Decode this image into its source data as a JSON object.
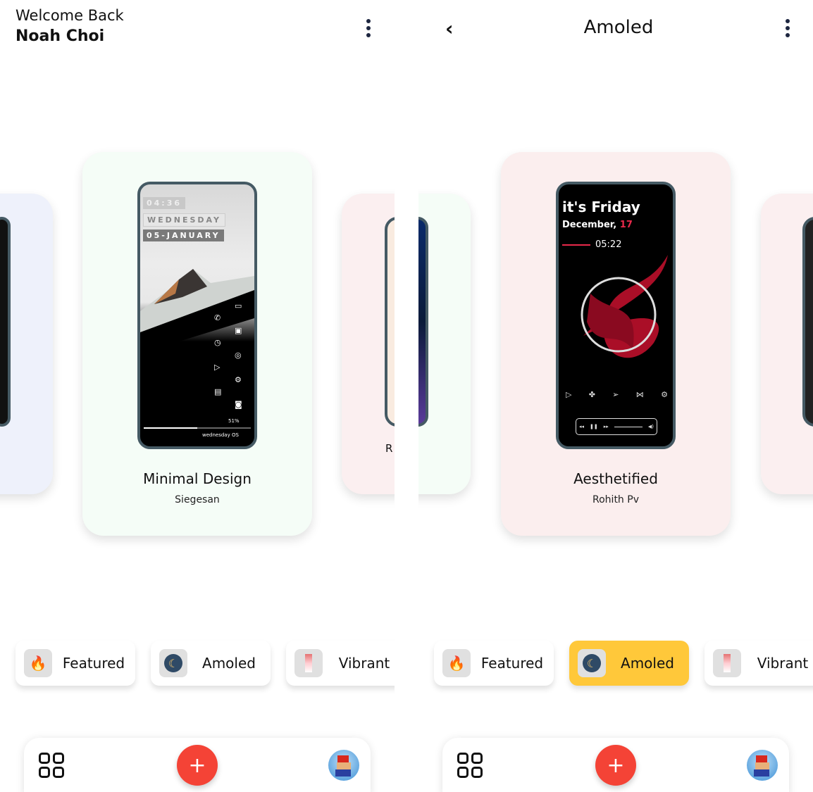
{
  "screens": [
    {
      "header": {
        "greeting": "Welcome Back",
        "user_name": "Noah Choi"
      },
      "cards": {
        "center": {
          "title": "Minimal Design",
          "author": "Siegesan",
          "preview": {
            "time": "04:36",
            "day": "WEDNESDAY",
            "date": "05-JANUARY",
            "battery": "51%",
            "footer": "wednesday OS",
            "progress": 0.5
          }
        },
        "right_partial_title": "R"
      },
      "chips": [
        {
          "label": "Featured",
          "icon": "fire-icon"
        },
        {
          "label": "Amoled",
          "icon": "moon-icon"
        },
        {
          "label": "Vibrant",
          "icon": "palette-icon"
        }
      ],
      "selected_chip": null
    },
    {
      "header": {
        "title": "Amoled"
      },
      "cards": {
        "center": {
          "title": "Aesthetified",
          "author": "Rohith Pv",
          "preview": {
            "headline": "it's Friday",
            "month": "December,",
            "day_num": "17",
            "time": "05:22"
          }
        }
      },
      "chips": [
        {
          "label": "Featured",
          "icon": "fire-icon"
        },
        {
          "label": "Amoled",
          "icon": "moon-icon"
        },
        {
          "label": "Vibrant",
          "icon": "palette-icon"
        }
      ],
      "selected_chip": "Amoled"
    }
  ],
  "colors": {
    "accent_fab": "#f44336",
    "selected_chip": "#ffc83a",
    "frame": "#455a64",
    "friday_red": "#e8294a"
  },
  "bottom_nav": {
    "add_label": "+"
  }
}
